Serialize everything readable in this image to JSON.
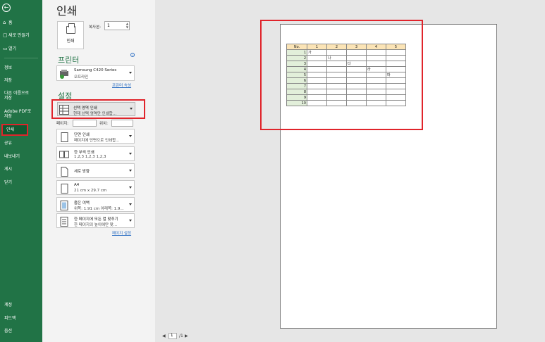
{
  "sidebar": {
    "back_icon": "back-arrow-icon",
    "top_items": [
      {
        "icon": "⌂",
        "label": "홈"
      },
      {
        "icon": "▢",
        "label": "새로 만들기"
      },
      {
        "icon": "▭",
        "label": "열기"
      }
    ],
    "mid_items": [
      "정보",
      "저장",
      "다른 이름으로",
      "저장",
      "Adobe PDF로",
      "저장",
      "인쇄",
      "공유",
      "내보내기",
      "게시",
      "닫기"
    ],
    "bottom_items": [
      "계정",
      "피드백",
      "옵션"
    ]
  },
  "page_title": "인쇄",
  "print_button": {
    "label": "인쇄"
  },
  "copies": {
    "label": "복사본:",
    "value": "1"
  },
  "printer": {
    "heading": "프린터",
    "name": "Samsung C420 Series",
    "status": "오프라인",
    "properties_link": "프린터 속성"
  },
  "settings": {
    "heading": "설정",
    "selected_area": {
      "title": "선택 영역 인쇄",
      "desc": "현재 선택 영역만 인쇄합..."
    },
    "pages_label": "페이지:",
    "to_label": "위치:",
    "sides": {
      "title": "단면 인쇄",
      "desc": "페이지에 단면으로 인쇄합..."
    },
    "collate": {
      "title": "한 부씩 인쇄",
      "desc": "1,2,3    1,2,3    1,2,3"
    },
    "orientation": {
      "title": "세로 방향"
    },
    "paper": {
      "title": "A4",
      "desc": "21 cm x 29.7 cm"
    },
    "margins": {
      "title": "좁은 여백",
      "desc": "위쪽: 1.91 cm 아래쪽: 1.9..."
    },
    "scaling": {
      "title": "한 페이지에 모든 열 맞추기",
      "desc": "한 페이지의 높이에만 맞..."
    },
    "page_setup_link": "페이지 설정"
  },
  "preview_sheet": {
    "headers": [
      "No.",
      "1",
      "2",
      "3",
      "4",
      "5"
    ],
    "rows": [
      [
        "1",
        "가",
        "",
        "",
        "",
        ""
      ],
      [
        "2",
        "",
        "나",
        "",
        "",
        ""
      ],
      [
        "3",
        "",
        "",
        "다",
        "",
        ""
      ],
      [
        "4",
        "",
        "",
        "",
        "라",
        ""
      ],
      [
        "5",
        "",
        "",
        "",
        "",
        "마"
      ],
      [
        "6",
        "",
        "",
        "",
        "",
        ""
      ],
      [
        "7",
        "",
        "",
        "",
        "",
        ""
      ],
      [
        "8",
        "",
        "",
        "",
        "",
        ""
      ],
      [
        "9",
        "",
        "",
        "",
        "",
        ""
      ],
      [
        "10",
        "",
        "",
        "",
        "",
        ""
      ]
    ]
  },
  "pager": {
    "current": "1",
    "total": "/1"
  }
}
